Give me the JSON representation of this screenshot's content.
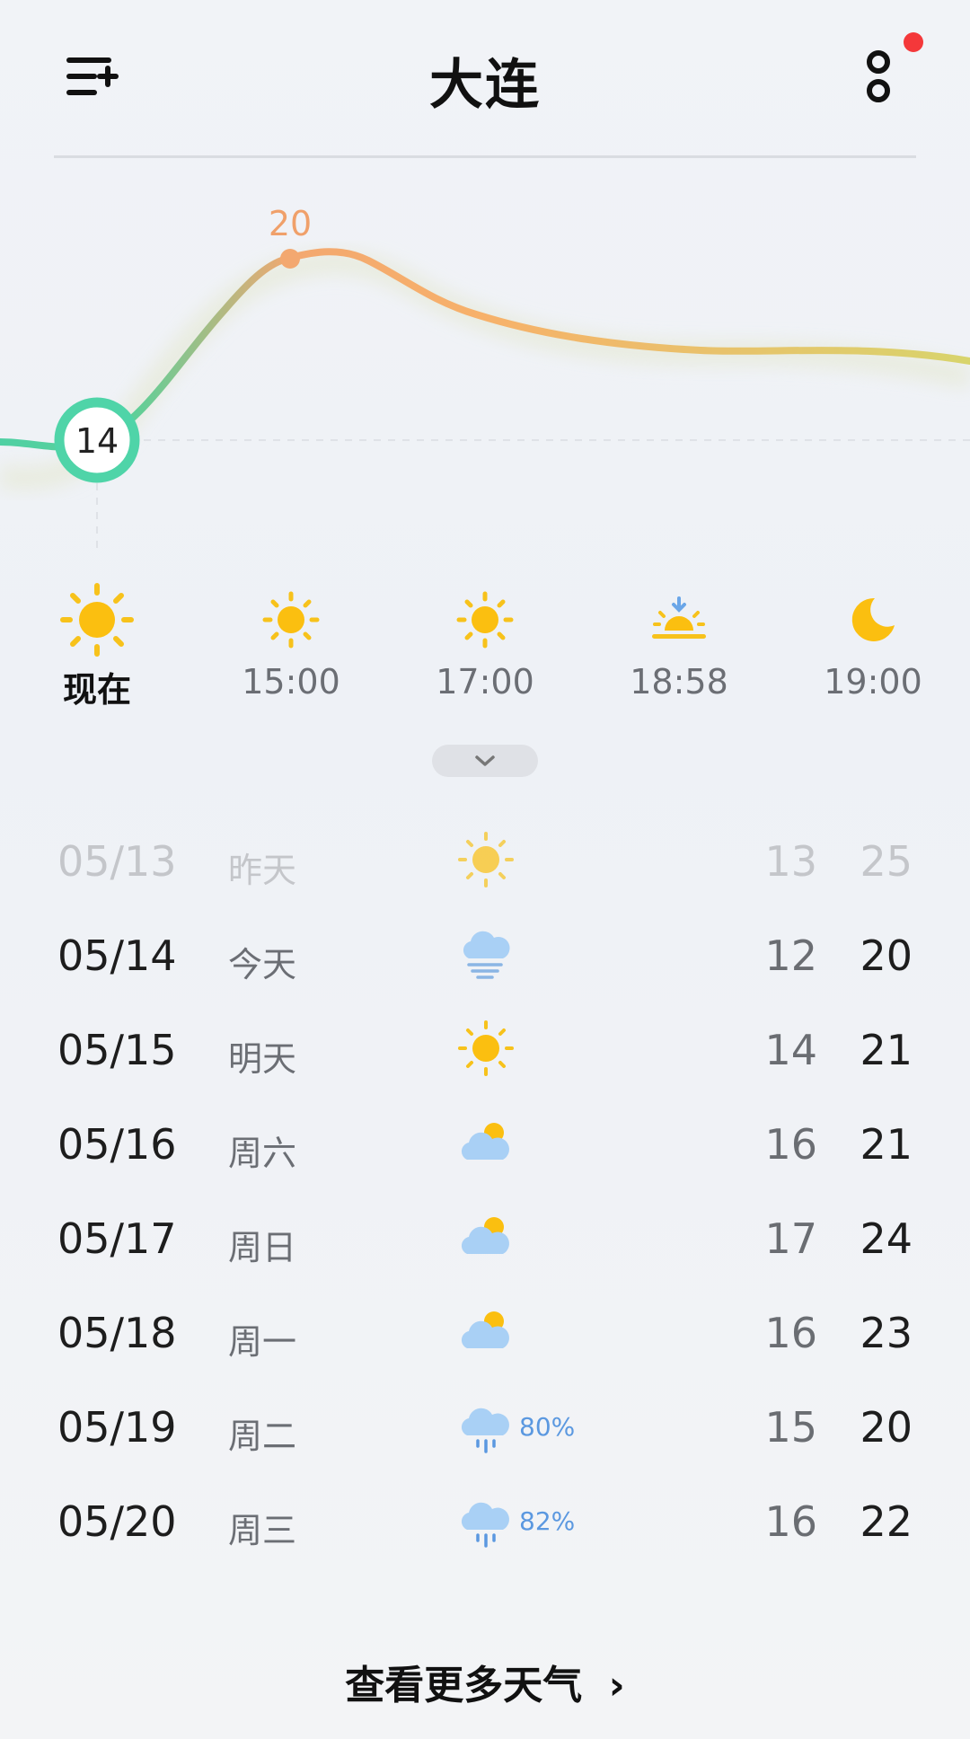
{
  "header": {
    "title": "大连"
  },
  "chart": {
    "now_temp": "14",
    "peak_temp": "20",
    "colors": {
      "start": "#4fd0a3",
      "peak": "#f7a86b",
      "end": "#d8d46c"
    }
  },
  "hours": [
    {
      "label": "现在",
      "icon": "sun-icon",
      "now": true
    },
    {
      "label": "15:00",
      "icon": "sun-icon"
    },
    {
      "label": "17:00",
      "icon": "sun-icon"
    },
    {
      "label": "18:58",
      "icon": "sunset-icon"
    },
    {
      "label": "19:00",
      "icon": "moon-icon"
    }
  ],
  "days": [
    {
      "date": "05/13",
      "name": "昨天",
      "icon": "sunny-icon",
      "precip": "",
      "low": "13",
      "high": "25",
      "past": true
    },
    {
      "date": "05/14",
      "name": "今天",
      "icon": "fog-icon",
      "precip": "",
      "low": "12",
      "high": "20"
    },
    {
      "date": "05/15",
      "name": "明天",
      "icon": "sunny-icon",
      "precip": "",
      "low": "14",
      "high": "21"
    },
    {
      "date": "05/16",
      "name": "周六",
      "icon": "partly-cloudy-icon",
      "precip": "",
      "low": "16",
      "high": "21"
    },
    {
      "date": "05/17",
      "name": "周日",
      "icon": "partly-cloudy-icon",
      "precip": "",
      "low": "17",
      "high": "24"
    },
    {
      "date": "05/18",
      "name": "周一",
      "icon": "partly-cloudy-icon",
      "precip": "",
      "low": "16",
      "high": "23"
    },
    {
      "date": "05/19",
      "name": "周二",
      "icon": "rain-icon",
      "precip": "80%",
      "low": "15",
      "high": "20"
    },
    {
      "date": "05/20",
      "name": "周三",
      "icon": "rain-icon",
      "precip": "82%",
      "low": "16",
      "high": "22"
    }
  ],
  "footer": {
    "more_label": "查看更多天气",
    "more_arrow": "›"
  }
}
